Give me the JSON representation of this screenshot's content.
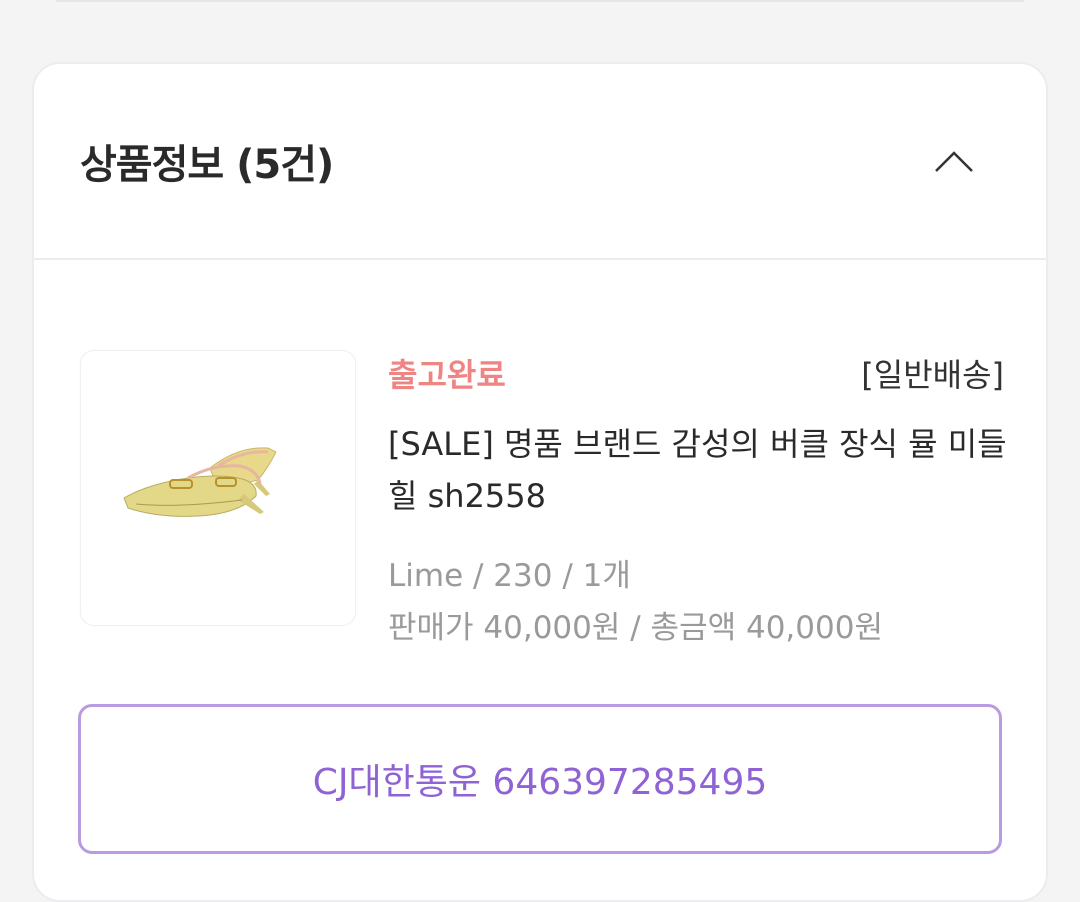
{
  "card": {
    "title": "상품정보 (5건)"
  },
  "item": {
    "status": "출고완료",
    "shipping_type": "[일반배송]",
    "name": "[SALE] 명품 브랜드 감성의 버클 장식 뮬 미들힐 sh2558",
    "options": "Lime / 230 / 1개",
    "price": "판매가 40,000원 / 총금액 40,000원",
    "image": "yellow-mule-heels-photo"
  },
  "tracking": {
    "label": "CJ대한통운 646397285495"
  },
  "icons": {
    "collapse": "chevron-up-icon"
  },
  "colors": {
    "status": "#ef8583",
    "accent": "#8f63d4",
    "accent_border": "#b89be0"
  }
}
